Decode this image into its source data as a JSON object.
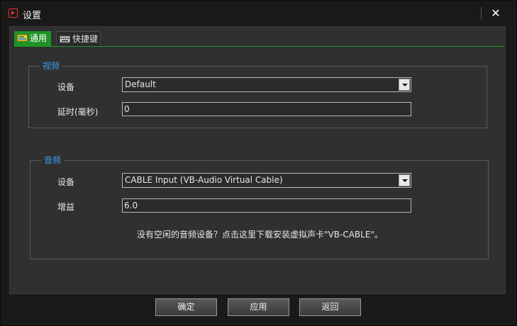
{
  "window": {
    "title": "设置"
  },
  "tabs": [
    {
      "label": "通用",
      "icon": "general-settings-icon",
      "active": true
    },
    {
      "label": "快捷键",
      "icon": "keyboard-icon",
      "active": false
    }
  ],
  "video": {
    "legend": "视频",
    "device_label": "设备",
    "device_value": "Default",
    "delay_label": "延时(毫秒)",
    "delay_value": "0"
  },
  "audio": {
    "legend": "音频",
    "device_label": "设备",
    "device_value": "CABLE Input (VB-Audio Virtual Cable)",
    "gain_label": "增益",
    "gain_value": "6.0",
    "hint": "没有空闲的音频设备？点击这里下载安装虚拟声卡\"VB-CABLE\"。"
  },
  "buttons": {
    "ok": "确定",
    "apply": "应用",
    "back": "返回"
  },
  "colors": {
    "accent_green": "#1f9426",
    "legend_blue": "#3d9be9",
    "icon_red": "#e03a3a"
  }
}
